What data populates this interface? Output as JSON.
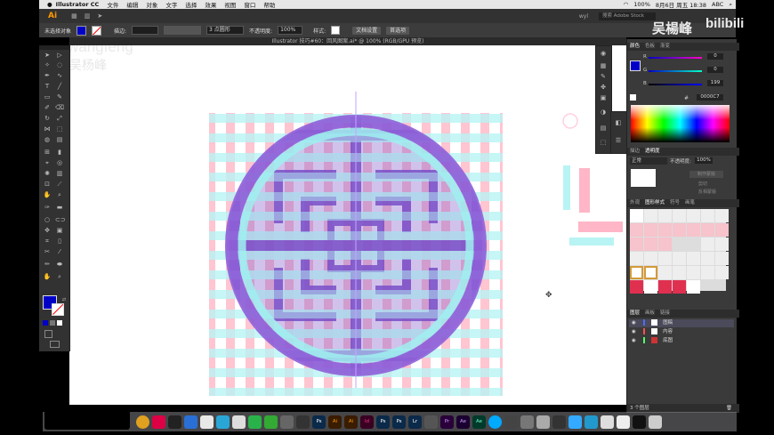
{
  "menubar": {
    "app_name": "Illustrator CC",
    "menus": [
      "文件",
      "编辑",
      "对象",
      "文字",
      "选择",
      "效果",
      "视图",
      "窗口",
      "帮助"
    ],
    "battery": "100%",
    "datetime": "8月6日 周五 18:38",
    "input": "ABC"
  },
  "appbar": {
    "logo": "Ai",
    "workspace": "wyl",
    "search_placeholder": "搜索 Adobe Stock"
  },
  "ctrlbar": {
    "selection": "未选择对象",
    "stroke_label": "描边:",
    "brush": "3 点圆形",
    "opacity_label": "不透明度:",
    "opacity_value": "100%",
    "style_label": "样式:",
    "doc_setup": "文档设置",
    "prefs": "首选项"
  },
  "document": {
    "tab_title": "Illustrator 技巧#60：回风图案.ai* @ 100% (RGB/GPU 预览)"
  },
  "watermark": {
    "latin": "wangfeng",
    "name": "吴杨峰",
    "corner_name": "吴楊峰",
    "site": "bilibili"
  },
  "panel": {
    "color_tabs": [
      "颜色",
      "色板",
      "渐变"
    ],
    "r_value": "0",
    "g_value": "0",
    "b_value": "199",
    "hex_value": "0000C7",
    "transparency_tabs": [
      "描边",
      "透明度"
    ],
    "blend_mode": "正常",
    "opacity_label": "不透明度:",
    "opacity_value": "100%",
    "make_mask": "制作蒙版",
    "clip": "剪切",
    "invert_mask": "反相蒙版",
    "swatch_tabs": [
      "外观",
      "图形样式",
      "符号",
      "画笔"
    ],
    "layers_tabs": [
      "图层",
      "画板",
      "链接"
    ],
    "layers": [
      {
        "name": "图稿",
        "color": "#4f6bff"
      },
      {
        "name": "内容",
        "color": "#ff4f4f"
      },
      {
        "name": "底图",
        "color": "#4fff6b"
      }
    ],
    "layers_footer": "3 个图层"
  },
  "dock": {
    "apps": [
      "Ps",
      "Ai",
      "Ai",
      "Id",
      "Ps",
      "Ps",
      "Lr",
      "",
      "Pr",
      "Ae",
      "Ae",
      "",
      "",
      "",
      ""
    ]
  },
  "colors": {
    "accent_blue": "#0000C7",
    "pink_grid": "#ffb6c6",
    "cyan_grid": "#b8f4f4",
    "purple_pattern": "#7a4fc8"
  }
}
